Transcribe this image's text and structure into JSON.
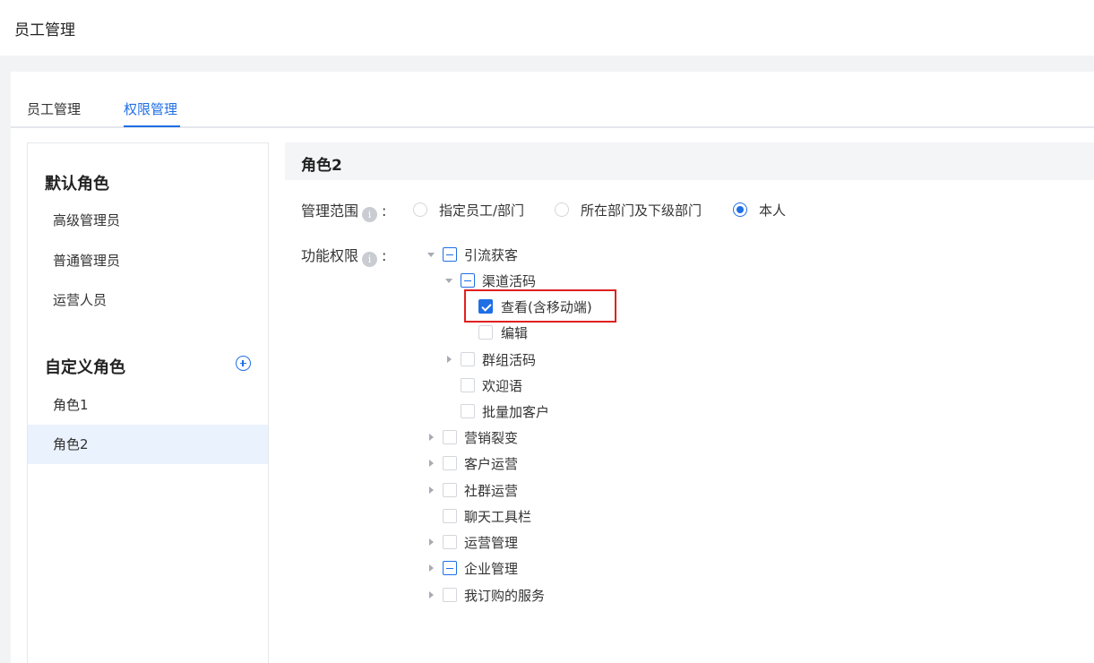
{
  "page": {
    "title": "员工管理"
  },
  "tabs": [
    {
      "label": "员工管理",
      "active": false
    },
    {
      "label": "权限管理",
      "active": true
    }
  ],
  "sidebar": {
    "default_group": "默认角色",
    "default_items": [
      "高级管理员",
      "普通管理员",
      "运营人员"
    ],
    "custom_group": "自定义角色",
    "custom_items": [
      "角色1",
      "角色2"
    ],
    "active_item": "角色2",
    "add_icon": "plus-circle-icon"
  },
  "main": {
    "role_title": "角色2",
    "scope_label": "管理范围",
    "scope_options": [
      {
        "label": "指定员工/部门",
        "selected": false
      },
      {
        "label": "所在部门及下级部门",
        "selected": false
      },
      {
        "label": "本人",
        "selected": true
      }
    ],
    "perm_label": "功能权限",
    "info_icon": "i",
    "colon": ":"
  },
  "tree": [
    {
      "label": "引流获客",
      "state": "indeterminate",
      "expanded": true
    },
    {
      "label": "渠道活码",
      "state": "indeterminate",
      "expanded": true
    },
    {
      "label": "查看(含移动端)",
      "state": "checked"
    },
    {
      "label": "编辑",
      "state": "unchecked"
    },
    {
      "label": "群组活码",
      "state": "unchecked",
      "expanded": false
    },
    {
      "label": "欢迎语",
      "state": "unchecked"
    },
    {
      "label": "批量加客户",
      "state": "unchecked"
    },
    {
      "label": "营销裂变",
      "state": "unchecked",
      "expanded": false
    },
    {
      "label": "客户运营",
      "state": "unchecked",
      "expanded": false
    },
    {
      "label": "社群运营",
      "state": "unchecked",
      "expanded": false
    },
    {
      "label": "聊天工具栏",
      "state": "unchecked"
    },
    {
      "label": "运营管理",
      "state": "unchecked",
      "expanded": false
    },
    {
      "label": "企业管理",
      "state": "indeterminate",
      "expanded": false
    },
    {
      "label": "我订购的服务",
      "state": "unchecked",
      "expanded": false
    }
  ],
  "colors": {
    "accent": "#1f6fe5",
    "highlight_box": "#e02020"
  }
}
